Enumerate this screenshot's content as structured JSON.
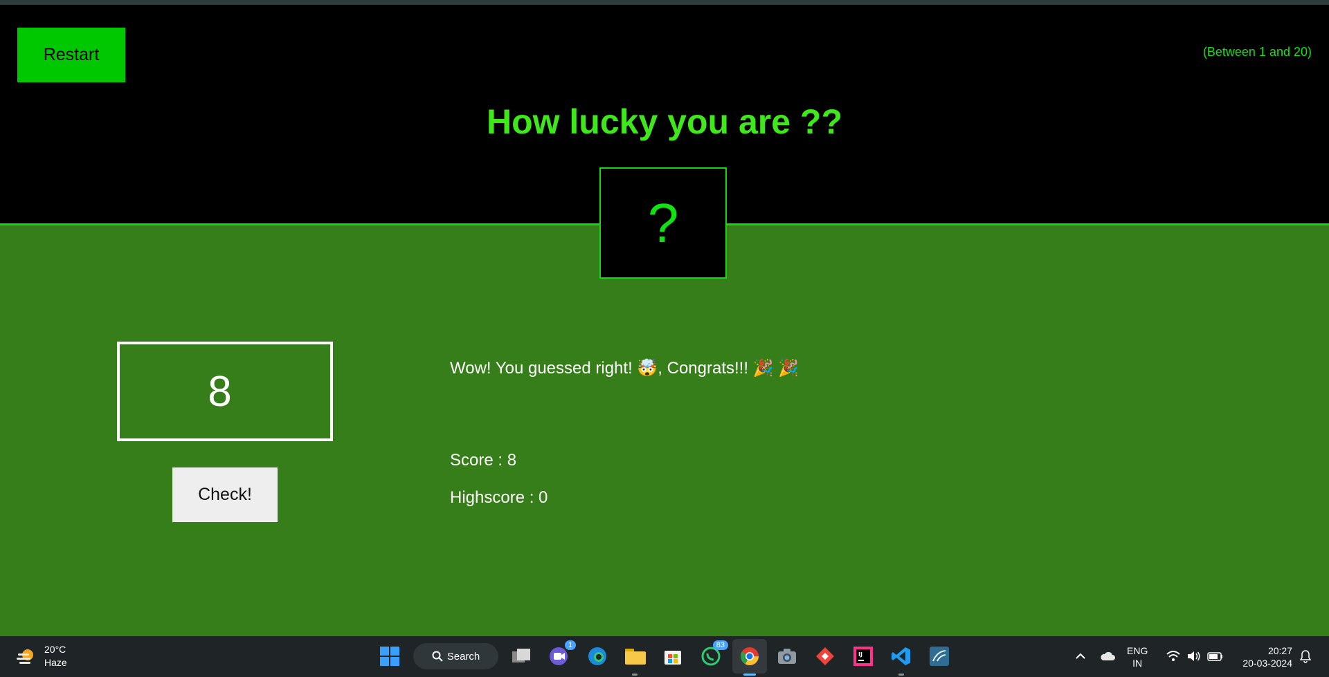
{
  "game": {
    "restart_label": "Restart",
    "range_hint": "(Between 1 and 20)",
    "title": "How lucky you are ??",
    "secret_number": "?",
    "guess_value": "8",
    "check_label": "Check!",
    "message": "Wow! You guessed right! 🤯, Congrats!!! 🎉 🎉",
    "score_text": "Score : 8",
    "highscore_text": "Highscore : 0"
  },
  "taskbar": {
    "weather_temp": "20°C",
    "weather_desc": "Haze",
    "search_label": "Search",
    "teams_badge": "1",
    "whatsapp_badge": "83",
    "lang_primary": "ENG",
    "lang_secondary": "IN",
    "time": "20:27",
    "date": "20-03-2024"
  },
  "colors": {
    "accent_green": "#3ee81a",
    "main_bg": "#367e19",
    "restart_bg": "#00c800"
  }
}
